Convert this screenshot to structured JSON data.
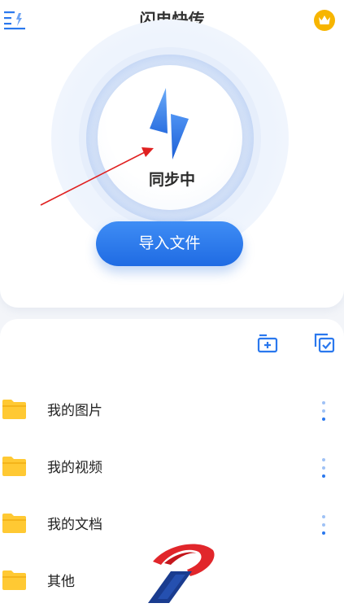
{
  "header": {
    "title": "闪电快传"
  },
  "sync": {
    "status": "同步中",
    "import_label": "导入文件"
  },
  "files": {
    "folders": [
      {
        "name": "我的图片",
        "has_more": true
      },
      {
        "name": "我的视频",
        "has_more": true
      },
      {
        "name": "我的文档",
        "has_more": true
      },
      {
        "name": "其他",
        "has_more": false
      }
    ]
  },
  "colors": {
    "accent": "#2a78ee",
    "folder": "#ffc933",
    "vip": "#f7b500",
    "annotation_arrow": "#e02020"
  },
  "icons": {
    "menu": "menu-bolt-icon",
    "vip": "crown-icon",
    "bolt": "lightning-bolt-icon",
    "new_folder": "new-folder-icon",
    "select": "multi-select-icon",
    "folder": "folder-icon",
    "more": "more-vertical-icon"
  }
}
